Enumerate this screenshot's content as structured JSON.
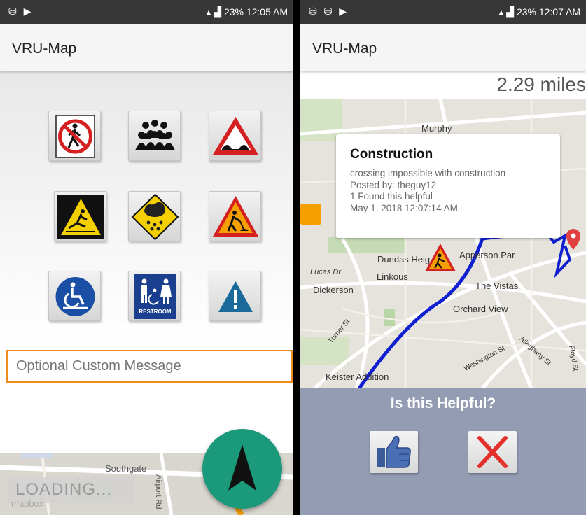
{
  "left_screen": {
    "status": {
      "left_icons": "⛁ ▶",
      "right_text": "23% 12:05 AM"
    },
    "app_title": "VRU-Map",
    "icons": [
      "no-pedestrian-icon",
      "crowd-icon",
      "road-bump-icon",
      "slippery-icon",
      "storm-icon",
      "construction-icon",
      "wheelchair-icon",
      "restroom-icon",
      "caution-icon"
    ],
    "restroom_text": "RESTROOM",
    "message_placeholder": "Optional Custom Message",
    "map": {
      "street_label": "Southgate",
      "airport_label": "Airport Rd",
      "attribution": "mapbox"
    },
    "loading_text": "LOADING..."
  },
  "right_screen": {
    "status": {
      "left_icons": "⛁ ⛁ ▶",
      "right_text": "23% 12:07 AM"
    },
    "app_title": "VRU-Map",
    "distance": "2.29 miles",
    "map_labels": {
      "murphy": "Murphy",
      "dundas": "Dundas Heig",
      "apperson": "Apperson Par",
      "lucas": "Lucas Dr",
      "linkous": "Linkous",
      "vistas": "The Vistas",
      "dickerson": "Dickerson",
      "orchard": "Orchard View",
      "turner": "Turner St",
      "washington": "Washington St",
      "alleghany": "Alleghany St",
      "floyd": "Floyd St",
      "keister": "Keister Addition"
    },
    "popup": {
      "title": "Construction",
      "description": "crossing impossible with construction",
      "posted_by": "Posted by: theguy12",
      "found_helpful": "1 Found this helpful",
      "timestamp": "May 1, 2018 12:07:14 AM"
    },
    "helpful_prompt": "Is this Helpful?",
    "colors": {
      "route": "#1020d0",
      "accent": "#ef8b1c",
      "fab": "#1a9a7a",
      "helpful_bg": "#949cb4"
    }
  }
}
